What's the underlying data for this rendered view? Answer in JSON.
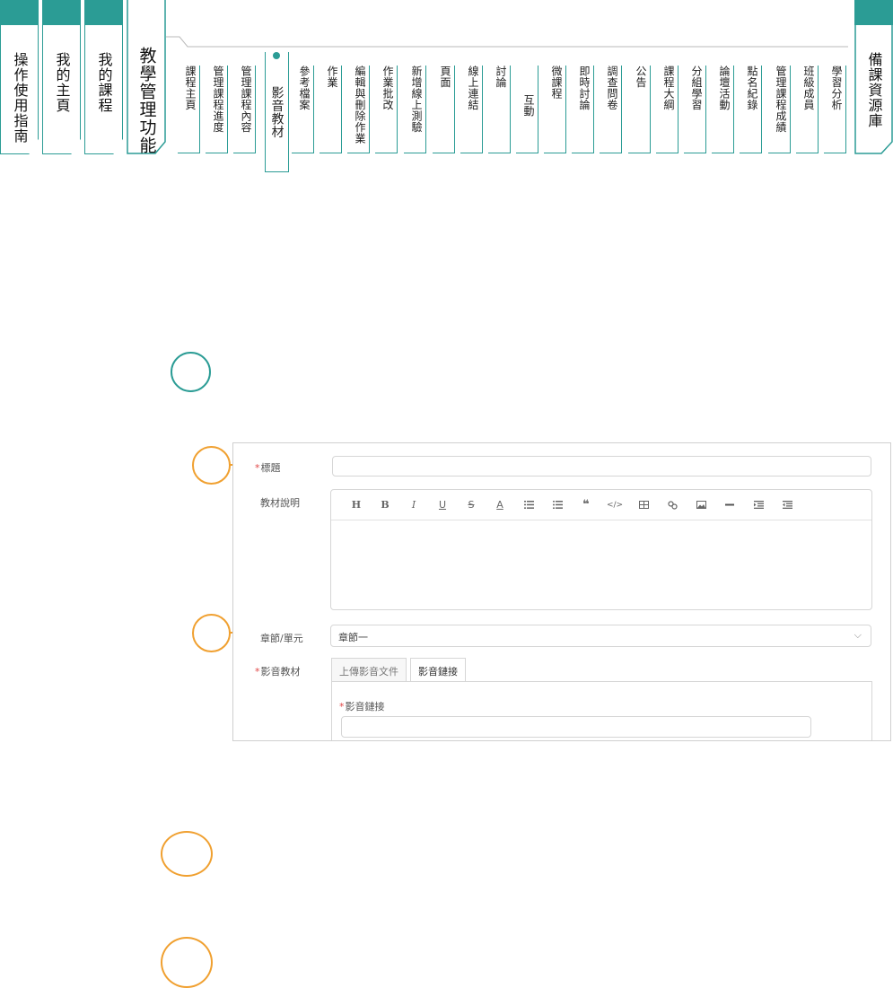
{
  "nav": {
    "big_tabs": [
      {
        "label": "操作使用指南"
      },
      {
        "label": "我的主頁"
      },
      {
        "label": "我的課程"
      }
    ],
    "main_tab": {
      "label": "教學管理功能"
    },
    "sub_tabs": [
      {
        "label": "課程主頁"
      },
      {
        "label": "管理課程進度"
      },
      {
        "label": "管理課程內容"
      },
      {
        "label": "影音教材",
        "active": true
      },
      {
        "label": "參考檔案"
      },
      {
        "label": "作業"
      },
      {
        "label": "編輯與刪除作業"
      },
      {
        "label": "作業批改"
      },
      {
        "label": "新增線上測驗"
      },
      {
        "label": "頁面"
      },
      {
        "label": "線上連結"
      },
      {
        "label": "討論"
      },
      {
        "label": "互動"
      },
      {
        "label": "微課程"
      },
      {
        "label": "即時討論"
      },
      {
        "label": "調查問卷"
      },
      {
        "label": "公告"
      },
      {
        "label": "課程大綱"
      },
      {
        "label": "分組學習"
      },
      {
        "label": "論壇活動"
      },
      {
        "label": "點名紀錄"
      },
      {
        "label": "管理課程成績"
      },
      {
        "label": "班級成員"
      },
      {
        "label": "學習分析"
      }
    ],
    "resource_tab": {
      "label": "備課資源庫"
    }
  },
  "form": {
    "title_label": "標題",
    "title_value": "",
    "desc_label": "教材說明",
    "toolbar": [
      "H",
      "B",
      "I",
      "U",
      "S",
      "A",
      "ordered-list-icon",
      "bullet-list-icon",
      "quote-icon",
      "code-icon",
      "table-icon",
      "link-icon",
      "image-icon",
      "hr-icon",
      "indent-icon",
      "outdent-icon"
    ],
    "chapter_label": "章節/單元",
    "chapter_value": "章節一",
    "media_label": "影音教材",
    "media_tabs": [
      "上傳影音文件",
      "影音鏈接"
    ],
    "media_tab_selected": 1,
    "link_label": "影音鏈接",
    "link_value": ""
  },
  "colors": {
    "teal": "#2b9c95",
    "orange": "#f0a030",
    "required": "#e04848"
  }
}
